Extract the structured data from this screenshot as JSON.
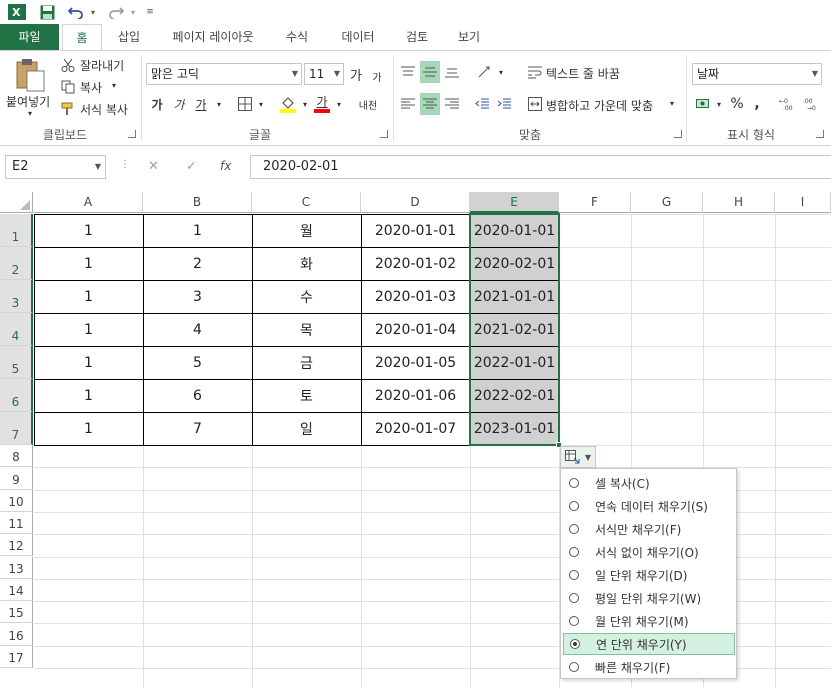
{
  "qat": {
    "app_icon": "excel-icon",
    "save_icon": "save-icon",
    "undo_icon": "undo-icon",
    "redo_icon": "redo-icon",
    "customize_icon": "customize-qat-icon"
  },
  "tabs": [
    {
      "label": "파일"
    },
    {
      "label": "홈"
    },
    {
      "label": "삽입"
    },
    {
      "label": "페이지 레이아웃"
    },
    {
      "label": "수식"
    },
    {
      "label": "데이터"
    },
    {
      "label": "검토"
    },
    {
      "label": "보기"
    }
  ],
  "ribbon": {
    "clipboard": {
      "paste": "붙여넣기",
      "cut": "잘라내기",
      "copy": "복사",
      "format_painter": "서식 복사",
      "label": "클립보드"
    },
    "font": {
      "name": "맑은 고딕",
      "size": "11",
      "grow": "가",
      "shrink": "가",
      "bold": "가",
      "italic": "가",
      "underline": "가",
      "font_color": "가",
      "phonetic": "내천",
      "label": "글꼴",
      "fill_color": "#ffff00",
      "text_color": "#ff0000"
    },
    "alignment": {
      "wrap_text": "텍스트 줄 바꿈",
      "merge_center": "병합하고 가운데 맞춤",
      "label": "맞춤"
    },
    "number": {
      "format": "날짜",
      "percent": "%",
      "comma": ",",
      "label": "표시 형식"
    }
  },
  "formula_bar": {
    "name_box": "E2",
    "cancel": "✕",
    "enter": "✓",
    "fx": "fx",
    "value": "2020-02-01"
  },
  "grid": {
    "columns": [
      "A",
      "B",
      "C",
      "D",
      "E",
      "F",
      "G",
      "H",
      "I"
    ],
    "rows": [
      "1",
      "2",
      "3",
      "4",
      "5",
      "6",
      "7",
      "8",
      "9",
      "10",
      "11",
      "12",
      "13",
      "14",
      "15",
      "16",
      "17"
    ],
    "data": [
      [
        "1",
        "1",
        "월",
        "2020-01-01",
        "2020-01-01"
      ],
      [
        "1",
        "2",
        "화",
        "2020-01-02",
        "2020-02-01"
      ],
      [
        "1",
        "3",
        "수",
        "2020-01-03",
        "2021-01-01"
      ],
      [
        "1",
        "4",
        "목",
        "2020-01-04",
        "2021-02-01"
      ],
      [
        "1",
        "5",
        "금",
        "2020-01-05",
        "2022-01-01"
      ],
      [
        "1",
        "6",
        "토",
        "2020-01-06",
        "2022-02-01"
      ],
      [
        "1",
        "7",
        "일",
        "2020-01-07",
        "2023-01-01"
      ]
    ],
    "selected_column": "E",
    "selection_color": "#d0d0d0",
    "accent_color": "#217346"
  },
  "autofill_menu": {
    "button_icon": "autofill-options-icon",
    "items": [
      {
        "label": "셀 복사(C)",
        "selected": false
      },
      {
        "label": "연속 데이터 채우기(S)",
        "selected": false
      },
      {
        "label": "서식만 채우기(F)",
        "selected": false
      },
      {
        "label": "서식 없이 채우기(O)",
        "selected": false
      },
      {
        "label": "일 단위 채우기(D)",
        "selected": false
      },
      {
        "label": "평일 단위 채우기(W)",
        "selected": false
      },
      {
        "label": "월 단위 채우기(M)",
        "selected": false
      },
      {
        "label": "연 단위 채우기(Y)",
        "selected": true
      },
      {
        "label": "빠른 채우기(F)",
        "selected": false
      }
    ]
  }
}
